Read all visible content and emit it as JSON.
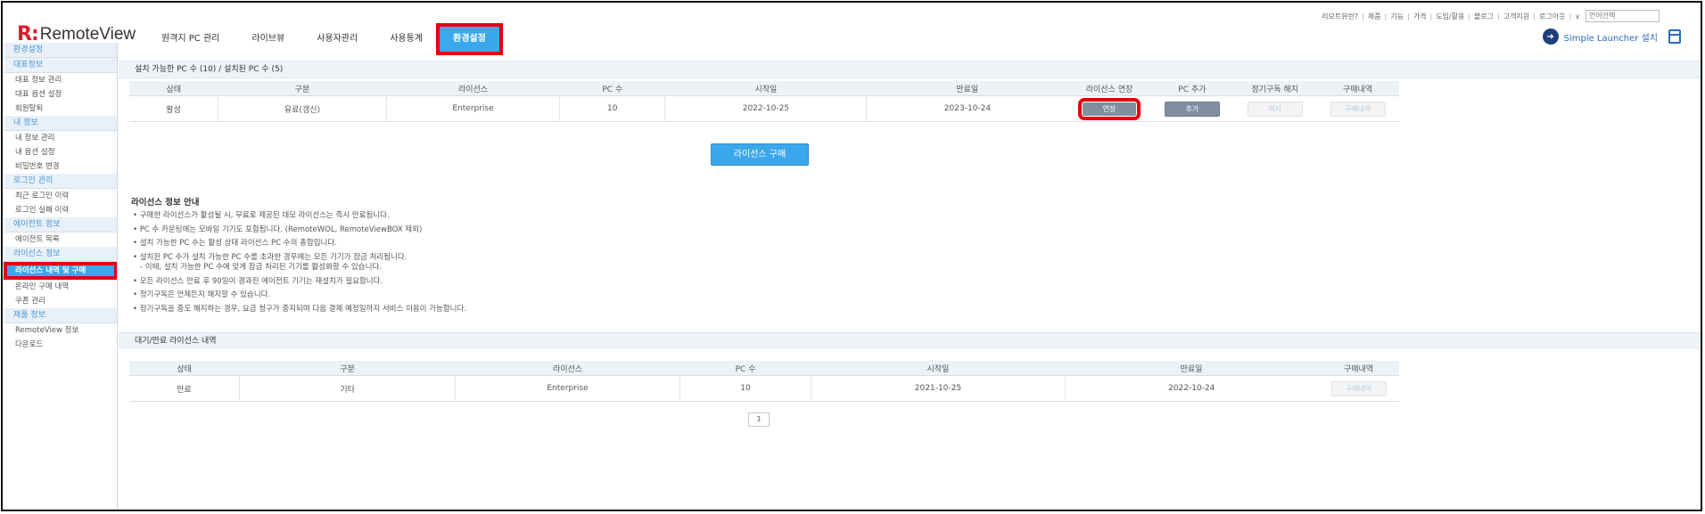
{
  "brand": {
    "mark": "R:",
    "name": "RemoteView"
  },
  "nav": [
    {
      "label": "원격지 PC 관리"
    },
    {
      "label": "라이브뷰"
    },
    {
      "label": "사용자관리"
    },
    {
      "label": "사용통계"
    },
    {
      "label": "환경설정"
    }
  ],
  "toplinks": [
    "리모트뷰란?",
    "제품",
    "기능",
    "가격",
    "도입/활용",
    "블로그",
    "고객지원",
    "로그아웃"
  ],
  "language_select": "언어선택",
  "launcher_label": "Simple Launcher 설치",
  "sidebar": [
    {
      "head": "환경설정",
      "items": []
    },
    {
      "head": "대표정보",
      "items": [
        "대표 정보 관리",
        "대표 옵션 설정",
        "회원탈퇴"
      ]
    },
    {
      "head": "내 정보",
      "items": [
        "내 정보 관리",
        "내 옵션 설정",
        "비밀번호 변경"
      ]
    },
    {
      "head": "로그인 관리",
      "items": [
        "최근 로그인 이력",
        "로그인 실패 이력"
      ]
    },
    {
      "head": "에이전트 정보",
      "items": [
        "에이전트 목록"
      ]
    },
    {
      "head": "라이선스 정보",
      "items": [
        "라이선스 내역 및 구매",
        "온라인 구매 내역",
        "쿠폰 관리"
      ]
    },
    {
      "head": "제품 정보",
      "items": [
        "RemoteView 정보",
        "다운로드"
      ]
    }
  ],
  "active_sidebar_item": "라이선스 내역 및 구매",
  "license_section": {
    "title": "설치 가능한 PC 수 (10) / 설치된 PC 수 (5)",
    "columns": [
      "상태",
      "구분",
      "라이선스",
      "PC 수",
      "시작일",
      "만료일",
      "라이선스 연장",
      "PC 추가",
      "정기구독 해지",
      "구매내역"
    ],
    "row": {
      "status": "활성",
      "type": "유료(갱신)",
      "license": "Enterprise",
      "pc_count": "10",
      "start": "2022-10-25",
      "end": "2023-10-24",
      "extend": "연장",
      "add": "추가",
      "cancel": "해지",
      "history": "구매내역"
    }
  },
  "buy_button": "라이선스 구매",
  "info": {
    "title": "라이선스 정보 안내",
    "lines": [
      "• 구매한 라이선스가 활성될 시, 무료로 제공된 데모 라이선스는 즉시 만료됩니다.",
      "• PC 수 카운팅에는 모바일 기기도 포함됩니다. (RemoteWOL, RemoteViewBOX 제외)",
      "• 설치 가능한 PC 수는 활성 상태 라이선스 PC 수의 총합입니다.",
      "• 설치된 PC 수가 설치 가능한 PC 수를 초과한 경우에는 모든 기기가 잠금 처리됩니다.",
      "- 이때, 설치 가능한 PC 수에 맞게 잠금 처리된 기기를 활성화할 수 있습니다.",
      "• 모든 라이선스 만료 후 90일이 경과된 에이전트 기기는 재설치가 필요합니다.",
      "• 정기구독은 언제든지 해지할 수 있습니다.",
      "• 정기구독을 중도 해지하는 경우, 요금 청구가 중지되며 다음 결제 예정일까지 서비스 이용이 가능합니다."
    ]
  },
  "expired_section": {
    "title": "대기/만료 라이선스 내역",
    "columns": [
      "상태",
      "구분",
      "라이선스",
      "PC 수",
      "시작일",
      "만료일",
      "구매내역"
    ],
    "row": {
      "status": "만료",
      "type": "기타",
      "license": "Enterprise",
      "pc_count": "10",
      "start": "2021-10-25",
      "end": "2022-10-24",
      "history": "구매내역"
    }
  },
  "page": "1"
}
